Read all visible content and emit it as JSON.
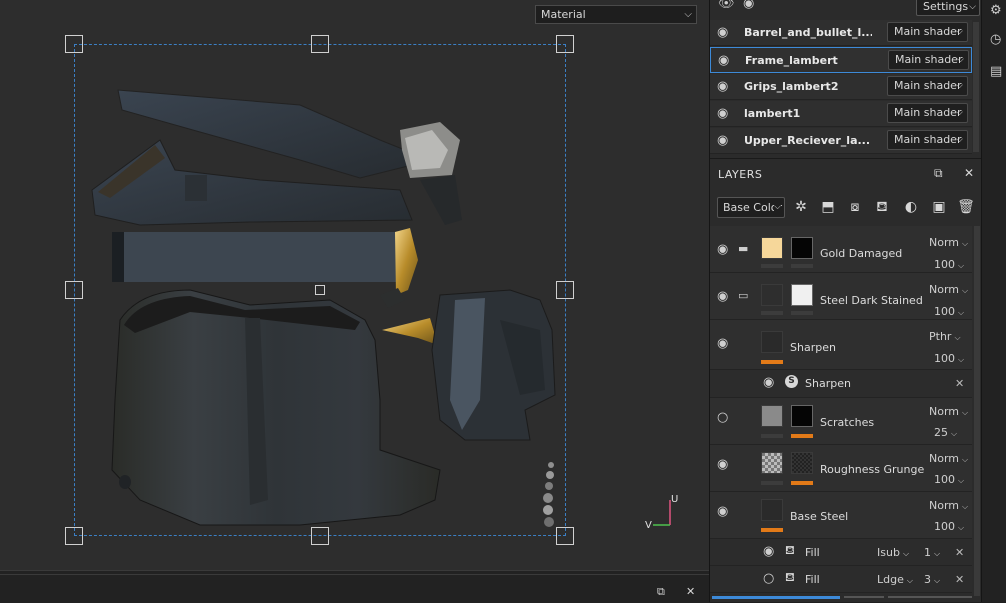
{
  "viewport": {
    "material_select": {
      "value": "Material"
    },
    "axis_labels": {
      "v": "V",
      "u": "U"
    }
  },
  "texture_sets": {
    "settings_label": "Settings",
    "items": [
      {
        "name": "Barrel_and_bullet_l...",
        "shader": "Main shader"
      },
      {
        "name": "Frame_lambert",
        "shader": "Main shader"
      },
      {
        "name": "Grips_lambert2",
        "shader": "Main shader"
      },
      {
        "name": "lambert1",
        "shader": "Main shader"
      },
      {
        "name": "Upper_Reciever_la...",
        "shader": "Main shader"
      }
    ]
  },
  "layers": {
    "title": "LAYERS",
    "channel": "Base Color",
    "rows": [
      {
        "name": "Gold Damaged",
        "blend": "Norm",
        "opacity": "100"
      },
      {
        "name": "Steel Dark Stained",
        "blend": "Norm",
        "opacity": "100"
      },
      {
        "name": "Sharpen",
        "blend": "Pthr",
        "opacity": "100"
      },
      {
        "name": "Sharpen"
      },
      {
        "name": "Scratches",
        "blend": "Norm",
        "opacity": "25"
      },
      {
        "name": "Roughness Grunge",
        "blend": "Norm",
        "opacity": "100"
      },
      {
        "name": "Base Steel",
        "blend": "Norm",
        "opacity": "100"
      },
      {
        "name": "Fill",
        "blend": "Isub",
        "opacity": "1"
      },
      {
        "name": "Fill",
        "blend": "Ldge",
        "opacity": "3"
      }
    ]
  },
  "colors": {
    "accent": "#3d8ad8",
    "mask_bar": "#e27a18",
    "gold_thumb": "#f6d79a"
  }
}
